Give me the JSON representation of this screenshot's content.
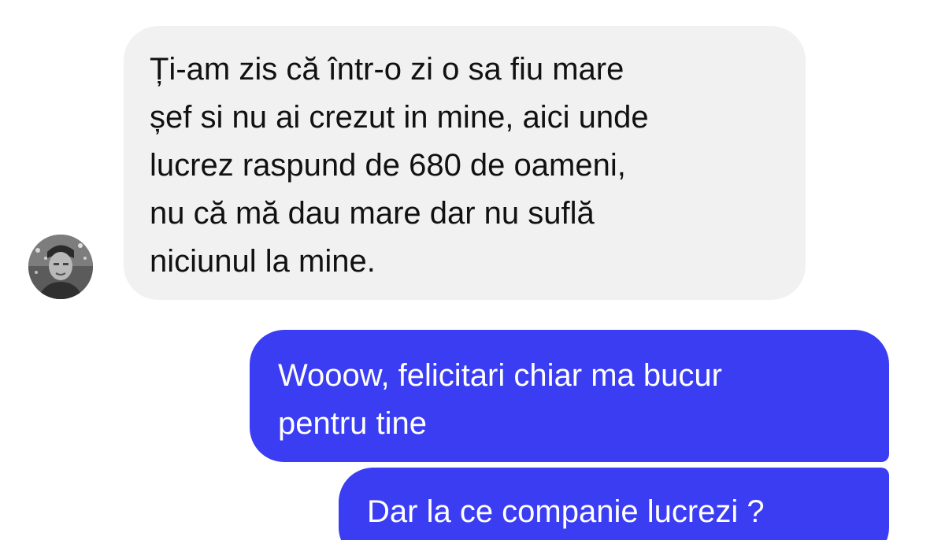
{
  "conversation": {
    "contact_avatar": "avatar-photo",
    "messages": [
      {
        "direction": "incoming",
        "lines": [
          "Ți-am zis că într-o zi o sa fiu mare",
          "șef si nu ai crezut in mine, aici unde",
          "lucrez raspund de 680 de oameni,",
          "nu că mă dau mare dar nu suflă",
          "niciunul la mine."
        ]
      },
      {
        "direction": "outgoing",
        "lines": [
          "Wooow, felicitari chiar ma bucur",
          "pentru tine"
        ]
      },
      {
        "direction": "outgoing",
        "lines": [
          "Dar la ce companie lucrezi ?"
        ]
      }
    ]
  },
  "colors": {
    "incoming_bubble": "#f1f1f1",
    "outgoing_bubble": "#3a3df2",
    "incoming_text": "#111111",
    "outgoing_text": "#ffffff"
  }
}
